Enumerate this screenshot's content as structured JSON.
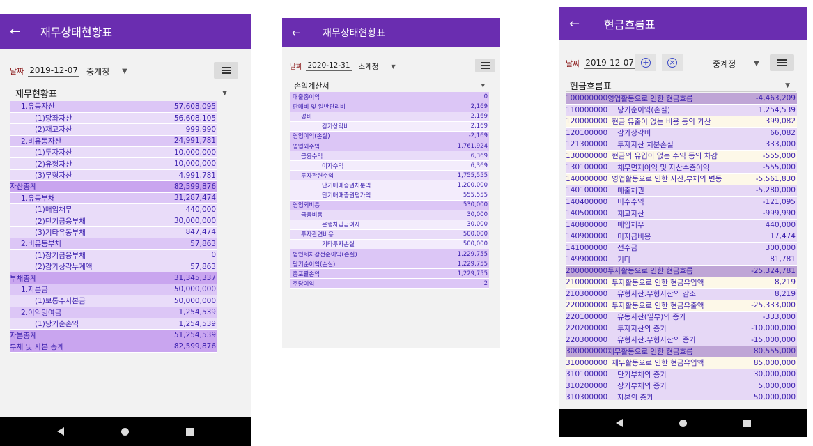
{
  "screen1": {
    "title": "재무상태현황표",
    "date_label": "날짜",
    "date": "2019-12-07",
    "account": "중계정",
    "combo": "재무현황표",
    "rows": [
      {
        "label": "1.유동자산",
        "value": "57,608,095",
        "level": 1
      },
      {
        "label": "(1)당좌자산",
        "value": "56,608,105",
        "level": 2
      },
      {
        "label": "(2)재고자산",
        "value": "999,990",
        "level": 2
      },
      {
        "label": "2.비유동자산",
        "value": "24,991,781",
        "level": 1
      },
      {
        "label": "(1)투자자산",
        "value": "10,000,000",
        "level": 2
      },
      {
        "label": "(2)유형자산",
        "value": "10,000,000",
        "level": 2
      },
      {
        "label": "(3)무형자산",
        "value": "4,991,781",
        "level": 2
      },
      {
        "label": "자산총계",
        "value": "82,599,876",
        "level": 0
      },
      {
        "label": "1.유동부채",
        "value": "31,287,474",
        "level": 1
      },
      {
        "label": "(1)매입채무",
        "value": "440,000",
        "level": 2
      },
      {
        "label": "(2)단기금융부채",
        "value": "30,000,000",
        "level": 2
      },
      {
        "label": "(3)기타유동부채",
        "value": "847,474",
        "level": 2
      },
      {
        "label": "2.비유동부채",
        "value": "57,863",
        "level": 1
      },
      {
        "label": "(1)장기금융부채",
        "value": "0",
        "level": 2
      },
      {
        "label": "(2)감가상각누계액",
        "value": "57,863",
        "level": 2
      },
      {
        "label": "부채총계",
        "value": "31,345,337",
        "level": 0
      },
      {
        "label": "1.자본금",
        "value": "50,000,000",
        "level": 1
      },
      {
        "label": "(1)보통주자본금",
        "value": "50,000,000",
        "level": 2
      },
      {
        "label": "2.이익잉여금",
        "value": "1,254,539",
        "level": 1
      },
      {
        "label": "(1)당기순손익",
        "value": "1,254,539",
        "level": 2
      },
      {
        "label": "자본총계",
        "value": "51,254,539",
        "level": 0
      },
      {
        "label": "부채 및 자본 총계",
        "value": "82,599,876",
        "level": 0
      }
    ]
  },
  "screen2": {
    "title": "재무상태현황표",
    "date_label": "날짜",
    "date": "2020-12-31",
    "account": "소계정",
    "combo": "손익계산서",
    "rows": [
      {
        "label": "매출총이익",
        "value": "0",
        "level": 1
      },
      {
        "label": "판매비 및 일반관리비",
        "value": "2,169",
        "level": 1
      },
      {
        "label": "경비",
        "value": "2,169",
        "level": 2
      },
      {
        "label": "감가상각비",
        "value": "2,169",
        "level": 3
      },
      {
        "label": "영업이익(손실)",
        "value": "-2,169",
        "level": 1
      },
      {
        "label": "영업외수익",
        "value": "1,761,924",
        "level": 1
      },
      {
        "label": "금융수익",
        "value": "6,369",
        "level": 2
      },
      {
        "label": "이자수익",
        "value": "6,369",
        "level": 3
      },
      {
        "label": "투자관련수익",
        "value": "1,755,555",
        "level": 2
      },
      {
        "label": "단기매매증권처분익",
        "value": "1,200,000",
        "level": 3
      },
      {
        "label": "단기매매증권평가익",
        "value": "555,555",
        "level": 3
      },
      {
        "label": "영업외비용",
        "value": "530,000",
        "level": 1
      },
      {
        "label": "금융비용",
        "value": "30,000",
        "level": 2
      },
      {
        "label": "은행차입금이자",
        "value": "30,000",
        "level": 3
      },
      {
        "label": "투자관련비용",
        "value": "500,000",
        "level": 2
      },
      {
        "label": "기타투자손실",
        "value": "500,000",
        "level": 3
      },
      {
        "label": "법인세차감전순이익(손실)",
        "value": "1,229,755",
        "level": 1
      },
      {
        "label": "당기순이익(손실)",
        "value": "1,229,755",
        "level": 1
      },
      {
        "label": "총포괄손익",
        "value": "1,229,755",
        "level": 1
      },
      {
        "label": "주당이익",
        "value": "2",
        "level": 1
      }
    ]
  },
  "screen3": {
    "title": "현금흐름표",
    "date_label": "날짜",
    "date": "2019-12-07",
    "add_symbol": "+",
    "clear_symbol": "×",
    "account": "중계정",
    "combo": "현금흐름표",
    "rows": [
      {
        "code": "100000000",
        "label": "영업활동으로 인한 현금흐름",
        "value": "-4,463,209",
        "level": 0
      },
      {
        "code": "110000000",
        "label": "당기순이익(손실)",
        "value": "1,254,539",
        "level": 1
      },
      {
        "code": "120000000",
        "label": "현금 유출이 없는 비용 등의 가산",
        "value": "399,082",
        "level": 2
      },
      {
        "code": "120100000",
        "label": "감가상각비",
        "value": "66,082",
        "level": 1
      },
      {
        "code": "121300000",
        "label": "투자자산 처분손실",
        "value": "333,000",
        "level": 1
      },
      {
        "code": "130000000",
        "label": "현금의 유입이 없는 수익 등의 차감",
        "value": "-555,000",
        "level": 2
      },
      {
        "code": "130100000",
        "label": "채무면제이익 및 자산수증이익",
        "value": "-555,000",
        "level": 1
      },
      {
        "code": "140000000",
        "label": "영업활동으로 인한 자산,부채의 변동",
        "value": "-5,561,830",
        "level": 2
      },
      {
        "code": "140100000",
        "label": "매출채권",
        "value": "-5,280,000",
        "level": 1
      },
      {
        "code": "140400000",
        "label": "미수수익",
        "value": "-121,095",
        "level": 1
      },
      {
        "code": "140500000",
        "label": "재고자산",
        "value": "-999,990",
        "level": 1
      },
      {
        "code": "140800000",
        "label": "매입채무",
        "value": "440,000",
        "level": 1
      },
      {
        "code": "140900000",
        "label": "미지급비용",
        "value": "17,474",
        "level": 1
      },
      {
        "code": "141000000",
        "label": "선수금",
        "value": "300,000",
        "level": 1
      },
      {
        "code": "149900000",
        "label": "기타",
        "value": "81,781",
        "level": 1
      },
      {
        "code": "200000000",
        "label": "투자활동으로 인한 현금흐름",
        "value": "-25,324,781",
        "level": 0
      },
      {
        "code": "210000000",
        "label": "투자활동으로 인한 현금유입액",
        "value": "8,219",
        "level": 2
      },
      {
        "code": "210300000",
        "label": "유형자산.무형자산의 감소",
        "value": "8,219",
        "level": 1
      },
      {
        "code": "220000000",
        "label": "투자활동으로 인한 현금유출액",
        "value": "-25,333,000",
        "level": 2
      },
      {
        "code": "220100000",
        "label": "유동자산(일부)의 증가",
        "value": "-333,000",
        "level": 1
      },
      {
        "code": "220200000",
        "label": "투자자산의 증가",
        "value": "-10,000,000",
        "level": 1
      },
      {
        "code": "220300000",
        "label": "유형자산.무형자산의 증가",
        "value": "-15,000,000",
        "level": 1
      },
      {
        "code": "300000000",
        "label": "재무활동으로 인한 현금흐름",
        "value": "80,555,000",
        "level": 0
      },
      {
        "code": "310000000",
        "label": "재무활동으로 인한 현금유입액",
        "value": "85,000,000",
        "level": 2
      },
      {
        "code": "310100000",
        "label": "단기부채의 증가",
        "value": "30,000,000",
        "level": 1
      },
      {
        "code": "310200000",
        "label": "장기부채의 증가",
        "value": "5,000,000",
        "level": 1
      },
      {
        "code": "310300000",
        "label": "자본의 증가",
        "value": "50,000,000",
        "level": 1
      }
    ]
  },
  "icons": {
    "back": "arrow-left-icon",
    "list": "list-icon",
    "dropdown": "triangle-down-icon",
    "nav_back": "nav-back-icon",
    "nav_home": "nav-home-icon",
    "nav_recents": "nav-recents-icon"
  },
  "colors": {
    "appbar": "#6a2db0",
    "row_total": "#c9a5ef",
    "row_group": "#dcc6f6",
    "row_item": "#e9dcf9",
    "row_highlight": "#fdf8e8",
    "text": "#3b1fae"
  }
}
